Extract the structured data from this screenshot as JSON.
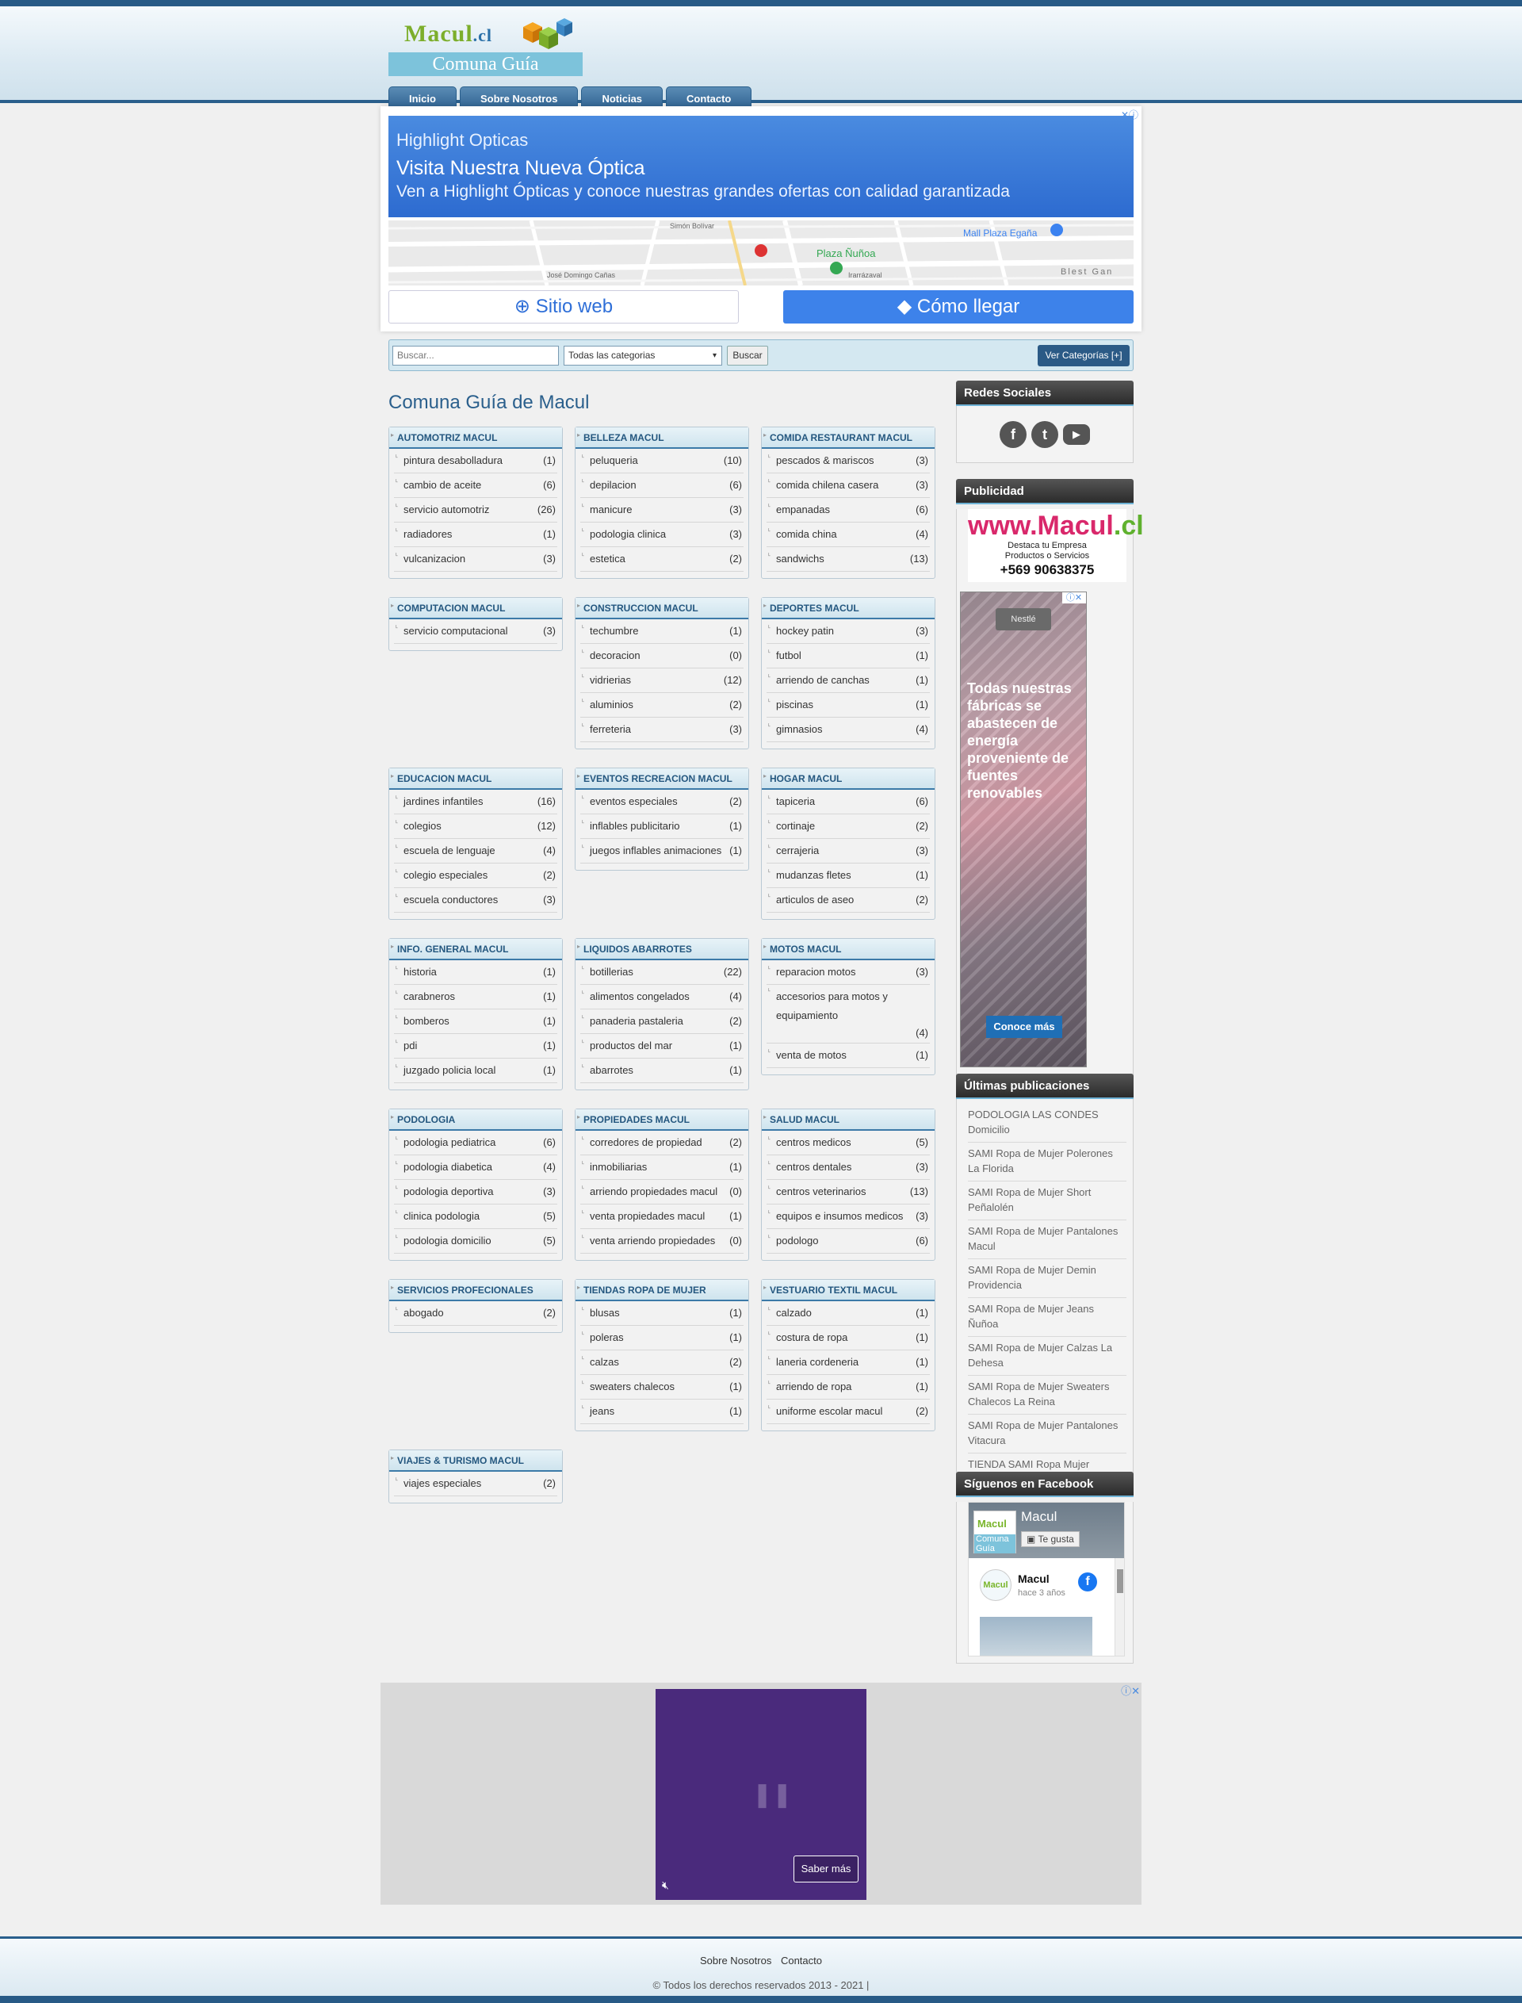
{
  "header": {
    "logo_main": "Macul",
    "logo_tld": ".cl",
    "logo_sub": "Comuna Guía",
    "nav": [
      "Inicio",
      "Sobre Nosotros",
      "Noticias",
      "Contacto"
    ]
  },
  "ad_top": {
    "brand": "Highlight Opticas",
    "headline": "Visita Nuestra Nueva Óptica",
    "description": "Ven a Highlight Ópticas y conoce nuestras grandes ofertas con calidad garantizada",
    "map_labels": {
      "mall": "Mall Plaza Egaña",
      "plaza": "Plaza Ñuñoa",
      "street1": "Simón Bolívar",
      "street2": "José Domingo Cañas",
      "street3": "Irarrázaval",
      "street4": "Blest Gan"
    },
    "btn_web": "Sitio web",
    "btn_dir": "Cómo llegar"
  },
  "search": {
    "placeholder": "Buscar...",
    "category_selected": "Todas las categorias",
    "button": "Buscar",
    "view_categories": "Ver Categorías [+]"
  },
  "main_title": "Comuna Guía de Macul",
  "categories": [
    {
      "title": "AUTOMOTRIZ MACUL",
      "items": [
        [
          "pintura desabolladura",
          "(1)"
        ],
        [
          "cambio de aceite",
          "(6)"
        ],
        [
          "servicio automotriz",
          "(26)"
        ],
        [
          "radiadores",
          "(1)"
        ],
        [
          "vulcanizacion",
          "(3)"
        ]
      ]
    },
    {
      "title": "BELLEZA MACUL",
      "items": [
        [
          "peluqueria",
          "(10)"
        ],
        [
          "depilacion",
          "(6)"
        ],
        [
          "manicure",
          "(3)"
        ],
        [
          "podologia clinica",
          "(3)"
        ],
        [
          "estetica",
          "(2)"
        ]
      ]
    },
    {
      "title": "COMIDA RESTAURANT MACUL",
      "items": [
        [
          "pescados & mariscos",
          "(3)"
        ],
        [
          "comida chilena casera",
          "(3)"
        ],
        [
          "empanadas",
          "(6)"
        ],
        [
          "comida china",
          "(4)"
        ],
        [
          "sandwichs",
          "(13)"
        ]
      ]
    },
    {
      "title": "COMPUTACION MACUL",
      "items": [
        [
          "servicio computacional",
          "(3)"
        ]
      ]
    },
    {
      "title": "CONSTRUCCION MACUL",
      "items": [
        [
          "techumbre",
          "(1)"
        ],
        [
          "decoracion",
          "(0)"
        ],
        [
          "vidrierias",
          "(12)"
        ],
        [
          "aluminios",
          "(2)"
        ],
        [
          "ferreteria",
          "(3)"
        ]
      ]
    },
    {
      "title": "DEPORTES MACUL",
      "items": [
        [
          "hockey patin",
          "(3)"
        ],
        [
          "futbol",
          "(1)"
        ],
        [
          "arriendo de canchas",
          "(1)"
        ],
        [
          "piscinas",
          "(1)"
        ],
        [
          "gimnasios",
          "(4)"
        ]
      ]
    },
    {
      "title": "EDUCACION MACUL",
      "items": [
        [
          "jardines infantiles",
          "(16)"
        ],
        [
          "colegios",
          "(12)"
        ],
        [
          "escuela de lenguaje",
          "(4)"
        ],
        [
          "colegio especiales",
          "(2)"
        ],
        [
          "escuela conductores",
          "(3)"
        ]
      ]
    },
    {
      "title": "EVENTOS RECREACION MACUL",
      "items": [
        [
          "eventos especiales",
          "(2)"
        ],
        [
          "inflables publicitario",
          "(1)"
        ],
        [
          "juegos inflables animaciones",
          "(1)"
        ]
      ]
    },
    {
      "title": "HOGAR MACUL",
      "items": [
        [
          "tapiceria",
          "(6)"
        ],
        [
          "cortinaje",
          "(2)"
        ],
        [
          "cerrajeria",
          "(3)"
        ],
        [
          "mudanzas fletes",
          "(1)"
        ],
        [
          "articulos de aseo",
          "(2)"
        ]
      ]
    },
    {
      "title": "INFO. GENERAL MACUL",
      "items": [
        [
          "historia",
          "(1)"
        ],
        [
          "carabneros",
          "(1)"
        ],
        [
          "bomberos",
          "(1)"
        ],
        [
          "pdi",
          "(1)"
        ],
        [
          "juzgado policia local",
          "(1)"
        ]
      ]
    },
    {
      "title": "LIQUIDOS ABARROTES",
      "items": [
        [
          "botillerias",
          "(22)"
        ],
        [
          "alimentos congelados",
          "(4)"
        ],
        [
          "panaderia pastaleria",
          "(2)"
        ],
        [
          "productos del mar",
          "(1)"
        ],
        [
          "abarrotes",
          "(1)"
        ]
      ]
    },
    {
      "title": "MOTOS MACUL",
      "items": [
        [
          "reparacion motos",
          "(3)"
        ],
        [
          "accesorios para motos y equipamiento",
          "(4)"
        ],
        [
          "venta de motos",
          "(1)"
        ]
      ]
    },
    {
      "title": "PODOLOGIA",
      "items": [
        [
          "podologia pediatrica",
          "(6)"
        ],
        [
          "podologia diabetica",
          "(4)"
        ],
        [
          "podologia deportiva",
          "(3)"
        ],
        [
          "clinica podologia",
          "(5)"
        ],
        [
          "podologia domicilio",
          "(5)"
        ]
      ]
    },
    {
      "title": "PROPIEDADES MACUL",
      "items": [
        [
          "corredores de propiedad",
          "(2)"
        ],
        [
          "inmobiliarias",
          "(1)"
        ],
        [
          "arriendo propiedades macul",
          "(0)"
        ],
        [
          "venta propiedades macul",
          "(1)"
        ],
        [
          "venta arriendo propiedades",
          "(0)"
        ]
      ]
    },
    {
      "title": "SALUD MACUL",
      "items": [
        [
          "centros medicos",
          "(5)"
        ],
        [
          "centros dentales",
          "(3)"
        ],
        [
          "centros veterinarios",
          "(13)"
        ],
        [
          "equipos e insumos medicos",
          "(3)"
        ],
        [
          "podologo",
          "(6)"
        ]
      ]
    },
    {
      "title": "SERVICIOS PROFECIONALES",
      "items": [
        [
          "abogado",
          "(2)"
        ]
      ]
    },
    {
      "title": "TIENDAS ROPA DE MUJER",
      "items": [
        [
          "blusas",
          "(1)"
        ],
        [
          "poleras",
          "(1)"
        ],
        [
          "calzas",
          "(2)"
        ],
        [
          "sweaters chalecos",
          "(1)"
        ],
        [
          "jeans",
          "(1)"
        ]
      ]
    },
    {
      "title": "VESTUARIO TEXTIL MACUL",
      "items": [
        [
          "calzado",
          "(1)"
        ],
        [
          "costura de ropa",
          "(1)"
        ],
        [
          "laneria cordeneria",
          "(1)"
        ],
        [
          "arriendo de ropa",
          "(1)"
        ],
        [
          "uniforme escolar macul",
          "(2)"
        ]
      ]
    },
    {
      "title": "VIAJES & TURISMO MACUL",
      "items": [
        [
          "viajes especiales",
          "(2)"
        ]
      ]
    }
  ],
  "sidebar": {
    "social_title": "Redes Sociales",
    "social_icons": [
      "facebook-icon",
      "twitter-icon",
      "youtube-icon"
    ],
    "ads_title": "Publicidad",
    "promo": {
      "url_main": "www.Macul",
      "url_tld": ".cl",
      "line1": "Destaca tu Empresa",
      "line2": "Productos o Servicios",
      "phone": "+569 90638375"
    },
    "nestle": {
      "logo": "Nestlé",
      "text": "Todas nuestras fábricas se abastecen de energía proveniente de fuentes renovables",
      "cta": "Conoce más"
    },
    "latest_title": "Últimas publicaciones",
    "latest": [
      "PODOLOGIA LAS CONDES Domicilio",
      "SAMI Ropa de Mujer Polerones La Florida",
      "SAMI Ropa de Mujer Short Peñalolén",
      "SAMI Ropa de Mujer Pantalones Macul",
      "SAMI Ropa de Mujer Demin Providencia",
      "SAMI Ropa de Mujer Jeans Ñuñoa",
      "SAMI Ropa de Mujer Calzas La Dehesa",
      "SAMI Ropa de Mujer Sweaters Chalecos La Reina",
      "SAMI Ropa de Mujer Pantalones Vitacura",
      "TIENDA SAMI Ropa Mujer Poleras Las condes"
    ],
    "facebook_title": "Síguenos en Facebook",
    "fb_page_name": "Macul",
    "fb_like": "Te gusta",
    "fb_post_name": "Macul",
    "fb_post_time": "hace 3 años"
  },
  "video_ad": {
    "cta": "Saber más"
  },
  "footer": {
    "links": [
      "Sobre Nosotros",
      "Contacto"
    ],
    "copyright": "© Todos los derechos reservados 2013 - 2021 |"
  },
  "colors": {
    "primary": "#275a86",
    "accent": "#7dc3db",
    "logo_green": "#7cae2b"
  }
}
